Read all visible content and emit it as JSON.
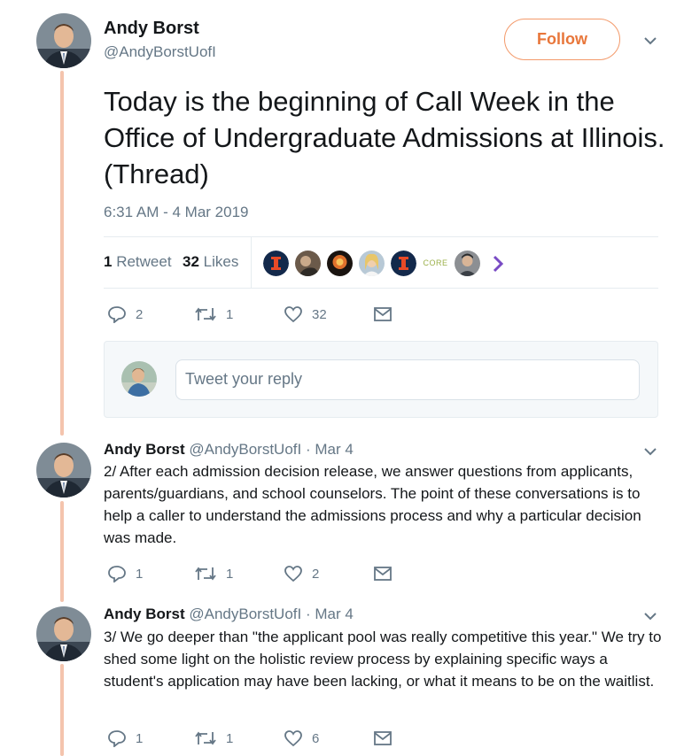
{
  "main_tweet": {
    "author_name": "Andy Borst",
    "author_handle": "@AndyBorstUofI",
    "follow_label": "Follow",
    "text": "Today is the beginning of Call Week in the Office of Undergraduate Admissions at Illinois. (Thread)",
    "timestamp": "6:31 AM - 4 Mar 2019",
    "retweet_count": "1",
    "retweet_label": "Retweet",
    "like_count": "32",
    "like_label": "Likes",
    "liker_badge_text": "CORE",
    "actions": {
      "reply": "2",
      "retweet": "1",
      "like": "32"
    }
  },
  "reply_composer": {
    "placeholder": "Tweet your reply"
  },
  "replies": [
    {
      "author_name": "Andy Borst",
      "author_handle": "@AndyBorstUofI",
      "date": "· Mar 4",
      "text": "2/ After each admission decision release, we answer questions from applicants, parents/guardians, and school counselors. The point of these conversations is to help a caller to understand the admissions process and why a particular decision was made.",
      "actions": {
        "reply": "1",
        "retweet": "1",
        "like": "2"
      }
    },
    {
      "author_name": "Andy Borst",
      "author_handle": "@AndyBorstUofI",
      "date": "· Mar 4",
      "text": "3/ We go deeper than \"the applicant pool was really competitive this year.\" We try to shed some light on the holistic review process by explaining specific ways a student's application may have been lacking, or what it means to be on the waitlist.",
      "actions": {
        "reply": "1",
        "retweet": "1",
        "like": "6"
      }
    }
  ],
  "colors": {
    "accent": "#e8763a",
    "thread_line": "#f4c4ad",
    "muted": "#657786",
    "illini_orange": "#e84a27",
    "illini_blue": "#13294b"
  }
}
